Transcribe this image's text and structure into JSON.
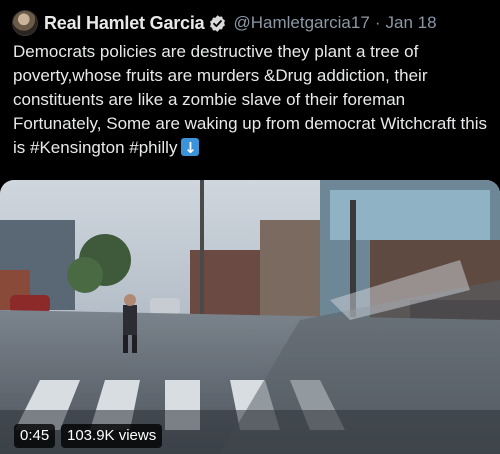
{
  "tweet": {
    "author": {
      "display_name": "Real Hamlet Garcia",
      "handle": "@Hamletgarcia17",
      "verified": true
    },
    "separator": "·",
    "date": "Jan 18",
    "text": "Democrats policies are destructive they plant a tree of poverty,whose fruits are murders &Drug addiction, their constituents are like a zombie slave of their foreman Fortunately, Some are waking up from democrat Witchcraft this is #Kensington #philly",
    "emoji": "arrow-down-emoji",
    "media": {
      "type": "video",
      "duration": "0:45",
      "views": "103.9K views"
    }
  },
  "colors": {
    "background": "#000000",
    "text": "#e7e9ea",
    "secondary": "#8b98a5",
    "verified_blue": "#1d9bf0"
  }
}
